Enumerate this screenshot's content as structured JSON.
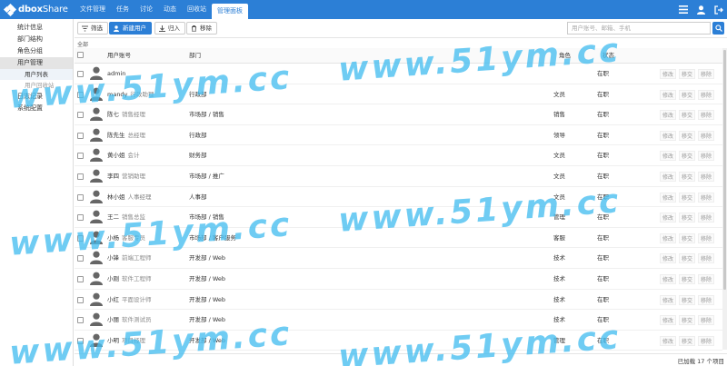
{
  "app": {
    "logo_prefix": "dbox",
    "logo_suffix": "Share"
  },
  "nav": {
    "tabs": [
      "文件管理",
      "任务",
      "讨论",
      "动态",
      "回收站",
      "管理面板"
    ],
    "active": 5
  },
  "sidebar": {
    "items": [
      "统计信息",
      "部门结构",
      "角色分组",
      "用户管理",
      "日志记录",
      "系统配置"
    ],
    "subitems": [
      "用户列表",
      "用户回收站"
    ]
  },
  "toolbar": {
    "filter_label": "筛选",
    "new_user_label": "新建用户",
    "import_label": "归入",
    "remove_label": "移除",
    "search_placeholder": "用户账号、邮箱、手机"
  },
  "filter_text": "全部",
  "table": {
    "headers": {
      "user": "用户账号",
      "dept": "部门",
      "role": "角色",
      "status": "状态"
    },
    "actions": [
      "修改",
      "移交",
      "移除"
    ],
    "rows": [
      {
        "name": "admin",
        "title": "",
        "dept": "",
        "role": "",
        "status": "在职"
      },
      {
        "name": "mandy",
        "title": "行政助理",
        "dept": "行政部",
        "role": "文员",
        "status": "在职"
      },
      {
        "name": "陈七",
        "title": "销售经理",
        "dept": "市场部 / 销售",
        "role": "销售",
        "status": "在职"
      },
      {
        "name": "陈先生",
        "title": "总经理",
        "dept": "行政部",
        "role": "领导",
        "status": "在职"
      },
      {
        "name": "黄小姐",
        "title": "会计",
        "dept": "财务部",
        "role": "文员",
        "status": "在职"
      },
      {
        "name": "李四",
        "title": "营销助理",
        "dept": "市场部 / 推广",
        "role": "文员",
        "status": "在职"
      },
      {
        "name": "林小姐",
        "title": "人事经理",
        "dept": "人事部",
        "role": "文员",
        "status": "在职"
      },
      {
        "name": "王二",
        "title": "销售总监",
        "dept": "市场部 / 销售",
        "role": "管理",
        "status": "在职"
      },
      {
        "name": "小杨",
        "title": "客服专员",
        "dept": "市场部 / 客户服务",
        "role": "客服",
        "status": "在职"
      },
      {
        "name": "小锋",
        "title": "前端工程师",
        "dept": "开发部 / Web",
        "role": "技术",
        "status": "在职"
      },
      {
        "name": "小刚",
        "title": "软件工程师",
        "dept": "开发部 / Web",
        "role": "技术",
        "status": "在职"
      },
      {
        "name": "小红",
        "title": "平面设计师",
        "dept": "开发部 / Web",
        "role": "技术",
        "status": "在职"
      },
      {
        "name": "小丽",
        "title": "软件测试员",
        "dept": "开发部 / Web",
        "role": "技术",
        "status": "在职"
      },
      {
        "name": "小明",
        "title": "项目经理",
        "dept": "开发部 / Web",
        "role": "管理",
        "status": "在职"
      }
    ]
  },
  "footer": {
    "loaded_text": "已加载 17 个项目"
  },
  "watermark": "www.51ym.cc",
  "colors": {
    "primary": "#2c7fd6",
    "watermark": "#46bef0"
  }
}
